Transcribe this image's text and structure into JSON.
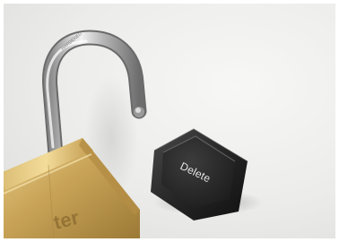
{
  "photo": {
    "subject": "open-padlock-and-keyboard-key",
    "key": {
      "label": "Delete"
    },
    "padlock": {
      "engraving": "ter"
    }
  }
}
